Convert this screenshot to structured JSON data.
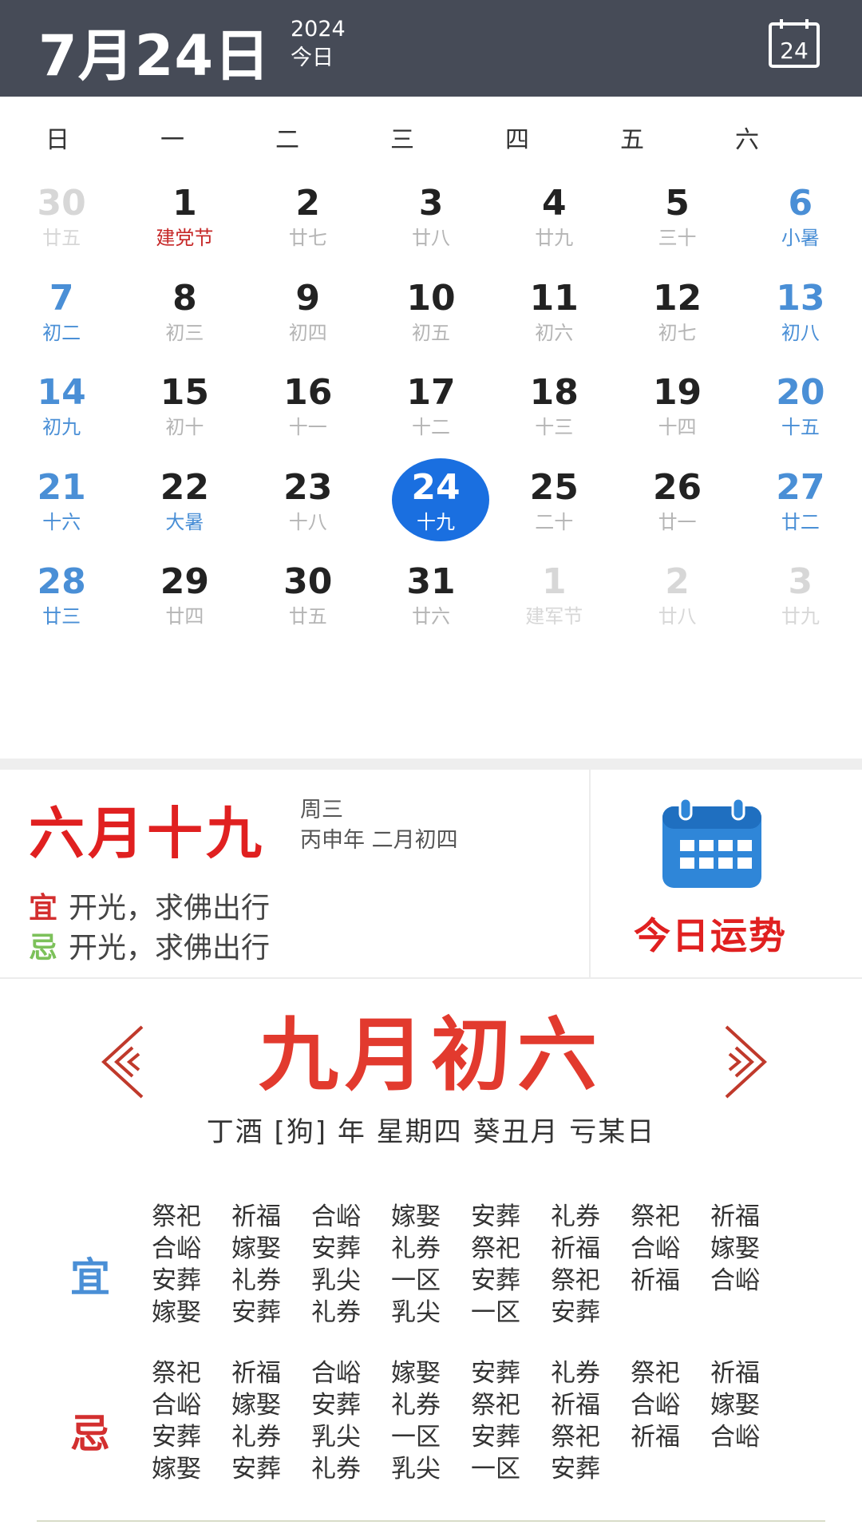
{
  "header": {
    "date": "7月24日",
    "year": "2024",
    "today_label": "今日",
    "calendar_button_day": "24",
    "bg_color": "#464b57"
  },
  "weekdays": [
    "日",
    "一",
    "二",
    "三",
    "四",
    "五",
    "六"
  ],
  "days": [
    {
      "num": "30",
      "lunar": "廿五",
      "kind": "other"
    },
    {
      "num": "1",
      "lunar": "建党节",
      "kind": "holiday"
    },
    {
      "num": "2",
      "lunar": "廿七",
      "kind": "normal"
    },
    {
      "num": "3",
      "lunar": "廿八",
      "kind": "normal"
    },
    {
      "num": "4",
      "lunar": "廿九",
      "kind": "normal"
    },
    {
      "num": "5",
      "lunar": "三十",
      "kind": "normal"
    },
    {
      "num": "6",
      "lunar": "小暑",
      "kind": "weekend"
    },
    {
      "num": "7",
      "lunar": "初二",
      "kind": "weekend"
    },
    {
      "num": "8",
      "lunar": "初三",
      "kind": "normal"
    },
    {
      "num": "9",
      "lunar": "初四",
      "kind": "normal"
    },
    {
      "num": "10",
      "lunar": "初五",
      "kind": "normal"
    },
    {
      "num": "11",
      "lunar": "初六",
      "kind": "normal"
    },
    {
      "num": "12",
      "lunar": "初七",
      "kind": "normal"
    },
    {
      "num": "13",
      "lunar": "初八",
      "kind": "weekend"
    },
    {
      "num": "14",
      "lunar": "初九",
      "kind": "weekend"
    },
    {
      "num": "15",
      "lunar": "初十",
      "kind": "normal"
    },
    {
      "num": "16",
      "lunar": "十一",
      "kind": "normal"
    },
    {
      "num": "17",
      "lunar": "十二",
      "kind": "normal"
    },
    {
      "num": "18",
      "lunar": "十三",
      "kind": "normal"
    },
    {
      "num": "19",
      "lunar": "十四",
      "kind": "normal"
    },
    {
      "num": "20",
      "lunar": "十五",
      "kind": "weekend"
    },
    {
      "num": "21",
      "lunar": "十六",
      "kind": "weekend"
    },
    {
      "num": "22",
      "lunar": "大暑",
      "kind": "term"
    },
    {
      "num": "23",
      "lunar": "十八",
      "kind": "normal"
    },
    {
      "num": "24",
      "lunar": "十九",
      "kind": "selected"
    },
    {
      "num": "25",
      "lunar": "二十",
      "kind": "normal"
    },
    {
      "num": "26",
      "lunar": "廿一",
      "kind": "normal"
    },
    {
      "num": "27",
      "lunar": "廿二",
      "kind": "weekend"
    },
    {
      "num": "28",
      "lunar": "廿三",
      "kind": "weekend"
    },
    {
      "num": "29",
      "lunar": "廿四",
      "kind": "normal"
    },
    {
      "num": "30",
      "lunar": "廿五",
      "kind": "normal"
    },
    {
      "num": "31",
      "lunar": "廿六",
      "kind": "normal"
    },
    {
      "num": "1",
      "lunar": "建军节",
      "kind": "other"
    },
    {
      "num": "2",
      "lunar": "廿八",
      "kind": "other"
    },
    {
      "num": "3",
      "lunar": "廿九",
      "kind": "other"
    }
  ],
  "info": {
    "lunar_date": "六月十九",
    "weekday": "周三",
    "ganzhi": "丙申年 二月初四",
    "yi_tag": "宜",
    "yi_text": "开光，求佛出行",
    "ji_tag": "忌",
    "ji_text": "开光，求佛出行",
    "fortune_label": "今日运势"
  },
  "almanac": {
    "title": "九月初六",
    "subtitle": "丁酒 [狗] 年  星期四  葵丑月  亏某日",
    "yi_tag": "宜",
    "ji_tag": "忌",
    "yi_words": [
      "祭祀",
      "祈福",
      "合峪",
      "嫁娶",
      "安葬",
      "礼券",
      "祭祀",
      "祈福",
      "合峪",
      "嫁娶",
      "安葬",
      "礼券",
      "祭祀",
      "祈福",
      "合峪",
      "嫁娶",
      "安葬",
      "礼券",
      "乳尖",
      "一区",
      "安葬",
      "祭祀",
      "祈福",
      "合峪",
      "嫁娶",
      "安葬",
      "礼券",
      "乳尖",
      "一区",
      "安葬"
    ],
    "ji_words": [
      "祭祀",
      "祈福",
      "合峪",
      "嫁娶",
      "安葬",
      "礼券",
      "祭祀",
      "祈福",
      "合峪",
      "嫁娶",
      "安葬",
      "礼券",
      "祭祀",
      "祈福",
      "合峪",
      "嫁娶",
      "安葬",
      "礼券",
      "乳尖",
      "一区",
      "安葬",
      "祭祀",
      "祈福",
      "合峪",
      "嫁娶",
      "安葬",
      "礼券",
      "乳尖",
      "一区",
      "安葬"
    ]
  },
  "colors": {
    "accent_blue": "#1a6fe0",
    "weekend_blue": "#4a8fd6",
    "red": "#e02020",
    "green": "#7cc15a"
  }
}
